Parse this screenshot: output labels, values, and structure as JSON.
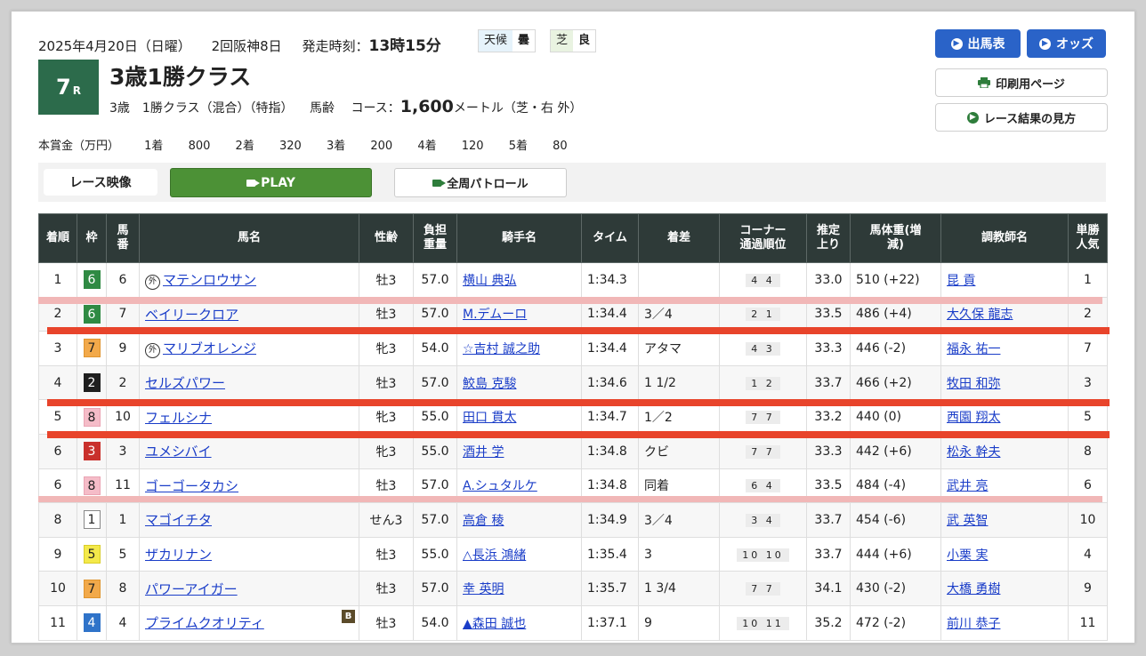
{
  "header": {
    "date": "2025年4月20日（日曜）",
    "meeting": "2回阪神8日",
    "start_label": "発走時刻：",
    "start_time": "13時15分",
    "weather_label": "天候",
    "weather": "曇",
    "track_label": "芝",
    "track": "良"
  },
  "race": {
    "number": "7",
    "suffix": "R",
    "title": "3歳1勝クラス",
    "cond1": "3歳　1勝クラス（混合）（特指）",
    "cond2": "馬齢",
    "course_label": "コース：",
    "distance": "1,600",
    "unit": "メートル（芝・右 外）"
  },
  "prize": {
    "label": "本賞金（万円）",
    "items": [
      "1着",
      "800",
      "2着",
      "320",
      "3着",
      "200",
      "4着",
      "120",
      "5着",
      "80"
    ]
  },
  "buttons": {
    "entries": "出馬表",
    "odds": "オッズ",
    "print": "印刷用ページ",
    "howto": "レース結果の見方"
  },
  "video": {
    "label": "レース映像",
    "play": "PLAY",
    "patrol": "全周パトロール"
  },
  "columns": [
    "着順",
    "枠",
    "馬番",
    "馬名",
    "性齢",
    "負担重量",
    "騎手名",
    "タイム",
    "着差",
    "コーナー通過順位",
    "推定上り",
    "馬体重(増減)",
    "調教師名",
    "単勝人気"
  ],
  "rows": [
    {
      "pos": "1",
      "waku": "6",
      "num": "6",
      "gai": "外",
      "name": "マテンロウサン",
      "sex": "牡3",
      "wt": "57.0",
      "jockey": "横山 典弘",
      "time": "1:34.3",
      "margin": "",
      "corner": "4 4",
      "agari": "33.0",
      "bw": "510 (+22)",
      "trainer": "昆 貢",
      "pop": "1"
    },
    {
      "pos": "2",
      "waku": "6",
      "num": "7",
      "gai": "",
      "name": "ベイリークロア",
      "sex": "牡3",
      "wt": "57.0",
      "jockey": "M.デムーロ",
      "time": "1:34.4",
      "margin": "3／4",
      "corner": "2 1",
      "agari": "33.5",
      "bw": "486 (+4)",
      "trainer": "大久保 龍志",
      "pop": "2"
    },
    {
      "pos": "3",
      "waku": "7",
      "num": "9",
      "gai": "外",
      "name": "マリブオレンジ",
      "sex": "牝3",
      "wt": "54.0",
      "jockey": "☆吉村 誠之助",
      "time": "1:34.4",
      "margin": "アタマ",
      "corner": "4 3",
      "agari": "33.3",
      "bw": "446 (-2)",
      "trainer": "福永 祐一",
      "pop": "7"
    },
    {
      "pos": "4",
      "waku": "2",
      "num": "2",
      "gai": "",
      "name": "セルズパワー",
      "sex": "牡3",
      "wt": "57.0",
      "jockey": "鮫島 克駿",
      "time": "1:34.6",
      "margin": "1 1/2",
      "corner": "1 2",
      "agari": "33.7",
      "bw": "466 (+2)",
      "trainer": "牧田 和弥",
      "pop": "3"
    },
    {
      "pos": "5",
      "waku": "8",
      "num": "10",
      "gai": "",
      "name": "フェルシナ",
      "sex": "牝3",
      "wt": "55.0",
      "jockey": "田口 貫太",
      "time": "1:34.7",
      "margin": "1／2",
      "corner": "7 7",
      "agari": "33.2",
      "bw": "440 (0)",
      "trainer": "西園 翔太",
      "pop": "5"
    },
    {
      "pos": "6",
      "waku": "3",
      "num": "3",
      "gai": "",
      "name": "ユメシバイ",
      "sex": "牝3",
      "wt": "55.0",
      "jockey": "酒井 学",
      "time": "1:34.8",
      "margin": "クビ",
      "corner": "7 7",
      "agari": "33.3",
      "bw": "442 (+6)",
      "trainer": "松永 幹夫",
      "pop": "8"
    },
    {
      "pos": "6",
      "waku": "8",
      "num": "11",
      "gai": "",
      "name": "ゴーゴータカシ",
      "sex": "牡3",
      "wt": "57.0",
      "jockey": "A.シュタルケ",
      "time": "1:34.8",
      "margin": "同着",
      "corner": "6 4",
      "agari": "33.5",
      "bw": "484 (-4)",
      "trainer": "武井 亮",
      "pop": "6"
    },
    {
      "pos": "8",
      "waku": "1",
      "num": "1",
      "gai": "",
      "name": "マゴイチタ",
      "sex": "せん3",
      "wt": "57.0",
      "jockey": "高倉 稜",
      "time": "1:34.9",
      "margin": "3／4",
      "corner": "3 4",
      "agari": "33.7",
      "bw": "454 (-6)",
      "trainer": "武 英智",
      "pop": "10"
    },
    {
      "pos": "9",
      "waku": "5",
      "num": "5",
      "gai": "",
      "name": "ザカリナン",
      "sex": "牡3",
      "wt": "55.0",
      "jockey": "△長浜 鴻緒",
      "time": "1:35.4",
      "margin": "3",
      "corner": "10 10",
      "agari": "33.7",
      "bw": "444 (+6)",
      "trainer": "小栗 実",
      "pop": "4"
    },
    {
      "pos": "10",
      "waku": "7",
      "num": "8",
      "gai": "",
      "name": "パワーアイガー",
      "sex": "牡3",
      "wt": "57.0",
      "jockey": "幸 英明",
      "time": "1:35.7",
      "margin": "1 3/4",
      "corner": "7 7",
      "agari": "34.1",
      "bw": "430 (-2)",
      "trainer": "大橋 勇樹",
      "pop": "9"
    },
    {
      "pos": "11",
      "waku": "4",
      "num": "4",
      "gai": "",
      "name": "プライムクオリティ",
      "sex": "牡3",
      "wt": "54.0",
      "jockey": "▲森田 誠也",
      "time": "1:37.1",
      "margin": "9",
      "corner": "10 11",
      "agari": "35.2",
      "bw": "472 (-2)",
      "trainer": "前川 恭子",
      "pop": "11"
    }
  ],
  "blinker": "B",
  "waku_colors": {
    "1": {
      "bg": "#ffffff",
      "fg": "#222222",
      "border": "#888888"
    },
    "2": {
      "bg": "#1f1f1f",
      "fg": "#ffffff",
      "border": "#1f1f1f"
    },
    "3": {
      "bg": "#c9302c",
      "fg": "#ffffff",
      "border": "#c9302c"
    },
    "4": {
      "bg": "#2f73c9",
      "fg": "#ffffff",
      "border": "#2f73c9"
    },
    "5": {
      "bg": "#f4e94a",
      "fg": "#222222",
      "border": "#d9cd2a"
    },
    "6": {
      "bg": "#2f8a43",
      "fg": "#ffffff",
      "border": "#2f8a43"
    },
    "7": {
      "bg": "#f2a94a",
      "fg": "#222222",
      "border": "#e0952f"
    },
    "8": {
      "bg": "#f5bcc8",
      "fg": "#222222",
      "border": "#eaa4b4"
    }
  }
}
